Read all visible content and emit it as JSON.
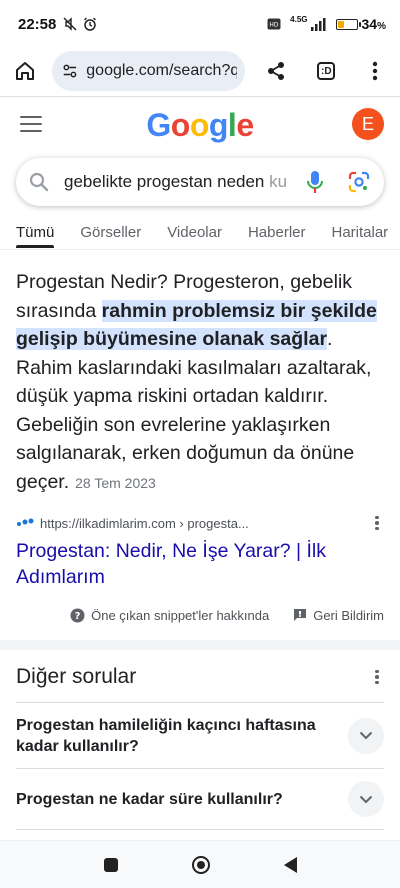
{
  "status": {
    "time": "22:58",
    "network": "4.5G",
    "battery_percent_text": "34",
    "battery_unit": "%",
    "battery_level": 0.34
  },
  "browser": {
    "url": "google.com/search?q=g",
    "tab_count": ":D"
  },
  "google": {
    "logo": [
      "G",
      "o",
      "o",
      "g",
      "l",
      "e"
    ],
    "logo_colors": [
      "#4285F4",
      "#EA4335",
      "#FBBC05",
      "#4285F4",
      "#34A853",
      "#EA4335"
    ],
    "avatar_letter": "E"
  },
  "search": {
    "query_visible": "gebelikte progestan neden ",
    "query_faded": "kull"
  },
  "tabs": [
    {
      "label": "Tümü",
      "active": true
    },
    {
      "label": "Görseller"
    },
    {
      "label": "Videolar"
    },
    {
      "label": "Haberler"
    },
    {
      "label": "Haritalar"
    }
  ],
  "snippet": {
    "text_before": "Progestan Nedir? Progesteron, gebelik sırasında ",
    "highlight": "rahmin problemsiz bir şekilde gelişip büyümesine olanak sağlar",
    "text_after": ". Rahim kaslarındaki kasılmaları azaltarak, düşük yapma riskini ortadan kaldırır. Gebeliğin son evrelerine yaklaşırken salgılanarak, erken doğumun da önüne geçer.",
    "date": "28 Tem 2023",
    "source_url": "https://ilkadimlarim.com › progesta...",
    "result_title": "Progestan: Nedir, Ne İşe Yarar? | İlk Adımlarım",
    "about_label": "Öne çıkan snippet'ler hakkında",
    "feedback_label": "Geri Bildirim"
  },
  "other_questions": {
    "heading": "Diğer sorular",
    "items": [
      "Progestan hamileliğin kaçıncı haftasına kadar kullanılır?",
      "Progestan ne kadar süre kullanılır?"
    ]
  },
  "colors": {
    "highlight_bg": "#d3e3fd",
    "link": "#1a0dab",
    "avatar_bg": "#f4511e"
  }
}
